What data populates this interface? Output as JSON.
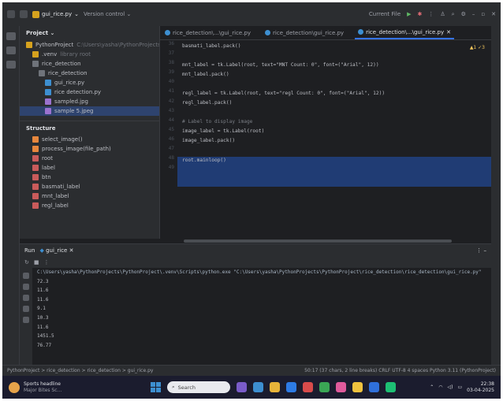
{
  "titlebar": {
    "project": "gui_rice.py",
    "vcs": "Version control",
    "run_config": "Current File"
  },
  "project_panel": {
    "title": "Project",
    "items": [
      {
        "label": "PythonProject",
        "detail": "C:\\Users\\yasha\\PythonProjects\\PythonP...",
        "indent": 0,
        "color": "#d6a21e"
      },
      {
        "label": ".venv",
        "detail": "library root",
        "indent": 1,
        "color": "#d6a21e"
      },
      {
        "label": "rice_detection",
        "detail": "",
        "indent": 1,
        "color": "#6f737a"
      },
      {
        "label": "rice_detection",
        "detail": "",
        "indent": 2,
        "color": "#6f737a"
      },
      {
        "label": "gui_rice.py",
        "detail": "",
        "indent": 3,
        "color": "#3d8fd1"
      },
      {
        "label": "rice detection.py",
        "detail": "",
        "indent": 3,
        "color": "#3d8fd1"
      },
      {
        "label": "sampled.jpg",
        "detail": "",
        "indent": 3,
        "color": "#9b72cf"
      },
      {
        "label": "sample 5.jpeg",
        "detail": "",
        "indent": 3,
        "color": "#9b72cf"
      }
    ]
  },
  "structure_panel": {
    "title": "Structure",
    "items": [
      "select_image()",
      "process_image(file_path)",
      "root",
      "label",
      "btn",
      "basmati_label",
      "mnt_label",
      "regl_label"
    ]
  },
  "editor": {
    "tabs": [
      {
        "label": "rice_detection\\...\\gui_rice.py",
        "active": false
      },
      {
        "label": "rice_detection\\gui_rice.py",
        "active": false
      },
      {
        "label": "rice_detection\\...\\gui_rice.py",
        "active": true
      }
    ],
    "warning": "▲1 ✓3",
    "lines": [
      {
        "num": "36",
        "text": "basmati_label.pack()"
      },
      {
        "num": "37",
        "text": ""
      },
      {
        "num": "38",
        "text": "mnt_label = tk.Label(root, text=\"MNT Count: 0\", font=(\"Arial\", 12))"
      },
      {
        "num": "39",
        "text": "mnt_label.pack()"
      },
      {
        "num": "40",
        "text": ""
      },
      {
        "num": "41",
        "text": "regl_label = tk.Label(root, text=\"regl Count: 0\", font=(\"Arial\", 12))"
      },
      {
        "num": "42",
        "text": "regl_label.pack()"
      },
      {
        "num": "43",
        "text": ""
      },
      {
        "num": "44",
        "text": "# Label to display image"
      },
      {
        "num": "45",
        "text": "image_label = tk.Label(root)"
      },
      {
        "num": "46",
        "text": "image_label.pack()"
      },
      {
        "num": "47",
        "text": ""
      },
      {
        "num": "48",
        "text": "root.mainloop()"
      },
      {
        "num": "49",
        "text": ""
      }
    ]
  },
  "run_panel": {
    "label": "Run",
    "config": "gui_rice",
    "console": [
      "C:\\Users\\yasha\\PythonProjects\\PythonProject\\.venv\\Scripts\\python.exe \"C:\\Users\\yasha\\PythonProjects\\PythonProject\\rice_detection\\rice_detection\\gui_rice.py\"",
      "72.3",
      "11.6",
      "11.6",
      "9.1",
      "10.3",
      "11.6",
      "1451.5",
      "76.77"
    ]
  },
  "statusbar": {
    "breadcrumb": "PythonProject > rice_detection > rice_detection > gui_rice.py",
    "info": "50:17 (37 chars, 2 line breaks)   CRLF   UTF-8   4 spaces   Python 3.11 (PythonProject)"
  },
  "taskbar": {
    "weather_title": "Sports headline",
    "weather_sub": "Major Bites Sc...",
    "search": "Search",
    "time": "22:38",
    "date": "03-04-2025"
  },
  "colors": {
    "bg": "#1e1f22",
    "panel": "#2b2d30",
    "accent": "#3574f0",
    "selection": "#214283"
  }
}
